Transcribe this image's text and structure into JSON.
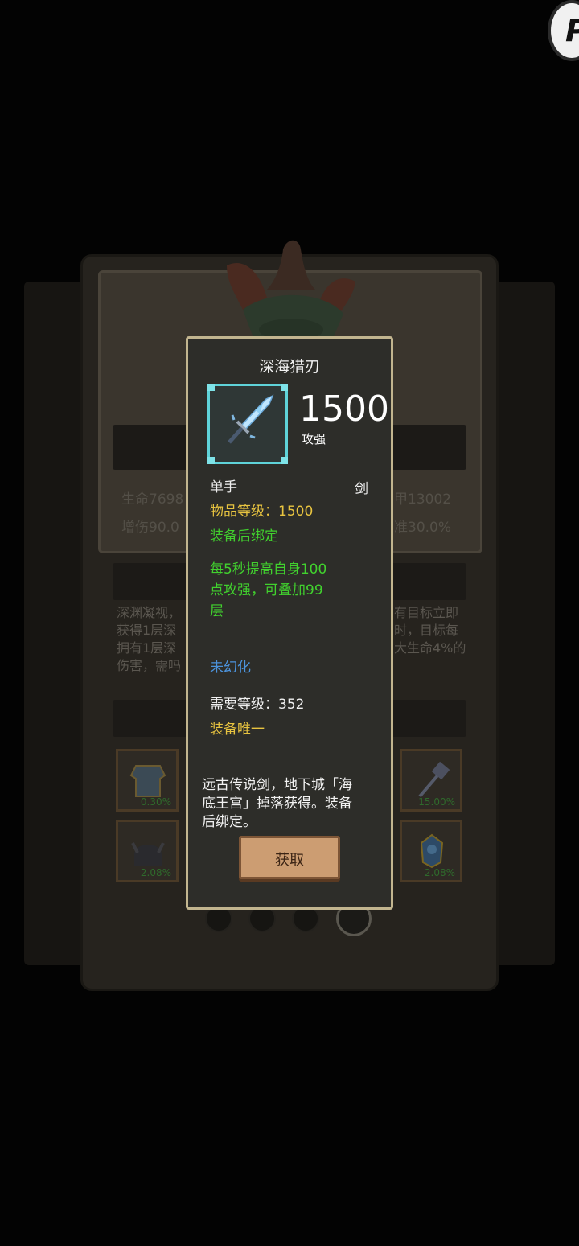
{
  "background": {
    "stats_left": [
      "生命7698",
      "增伤90.0"
    ],
    "stats_right": [
      "甲13002",
      "准30.0%"
    ],
    "description_fragments": [
      [
        "深渊凝视，",
        "有目标立即"
      ],
      [
        "获得1层深",
        "时，目标每"
      ],
      [
        "拥有1层深",
        "大生命4%的"
      ],
      [
        "伤害，需吗",
        ""
      ]
    ],
    "slots": [
      {
        "icon": "armor-icon",
        "percent": "0.30%"
      },
      {
        "icon": "hammer-icon",
        "percent": "15.00%"
      },
      {
        "icon": "helmet-icon",
        "percent": "2.08%"
      },
      {
        "icon": "trinket-icon",
        "percent": "2.08%"
      }
    ],
    "page_dots": 4,
    "active_dot": 3
  },
  "tooltip": {
    "title": "深海猎刃",
    "icon": "sword-icon",
    "stat_value": "1500",
    "stat_label": "攻强",
    "hand_type": "单手",
    "weapon_type": "剑",
    "item_level": "物品等级：1500",
    "bind_line": "装备后绑定",
    "effect_lines": [
      "每5秒提高自身100",
      "点攻强，可叠加99",
      "层"
    ],
    "transmog": "未幻化",
    "required_level": "需要等级：352",
    "unique": "装备唯一",
    "flavor_lines": [
      "远古传说剑，地下城「海",
      "底王宫」掉落获得。装备",
      "后绑定。"
    ],
    "obtain_button": "获取"
  },
  "colors": {
    "frame_border": "#c2b58f",
    "item_frame": "#5fd3d9",
    "level_text": "#e8c440",
    "bind_text": "#41d12e",
    "transmog_text": "#4c93dc",
    "button": "#cc9d72"
  }
}
